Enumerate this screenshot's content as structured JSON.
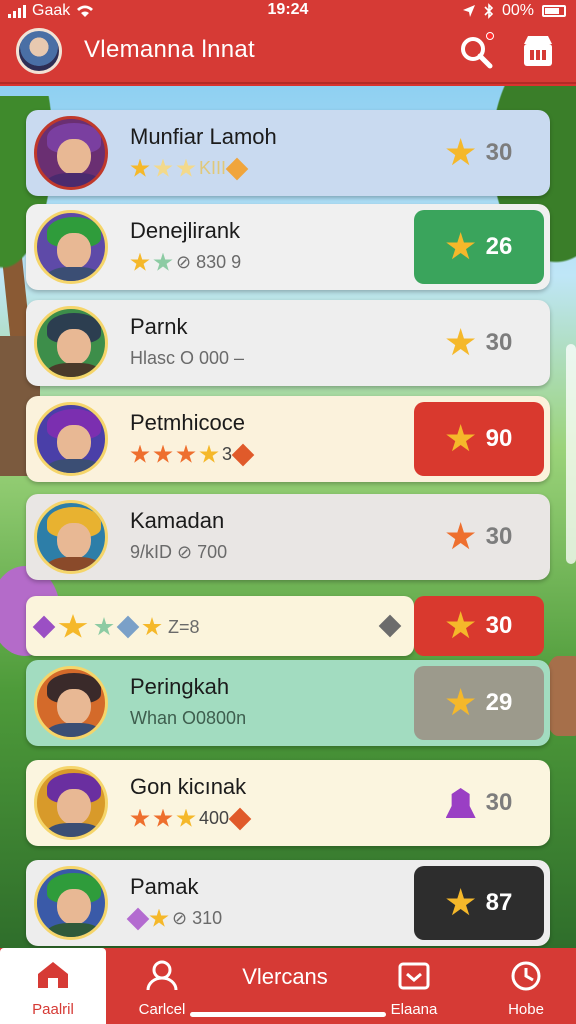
{
  "status_bar": {
    "carrier": "Gaak",
    "time": "19:24",
    "battery": "00%"
  },
  "header": {
    "title": "Vlemanna lnnat",
    "search_icon": "search-icon",
    "shop_icon": "shop-icon"
  },
  "rows": [
    {
      "name": "Munfiar Lamoh",
      "sub": "KIII",
      "score": "30",
      "score_bg": "none"
    },
    {
      "name": "Denejlirank",
      "sub": "⊘ 830 9",
      "score": "26",
      "score_bg": "#3aa45c"
    },
    {
      "name": "Parnk",
      "sub": "Hlasc O 000 –",
      "score": "30",
      "score_bg": "none"
    },
    {
      "name": "Petmhicoce",
      "sub": "3",
      "score": "90",
      "score_bg": "#d9392e"
    },
    {
      "name": "Kamadan",
      "sub": "9/kID ⊘ 700",
      "score": "30",
      "score_bg": "none"
    },
    {
      "name": "",
      "sub": "Z=8",
      "score": "30",
      "score_bg": "#d9392e"
    },
    {
      "name": "Peringkah",
      "sub": "Whan O0800n",
      "score": "29",
      "score_bg": "#9c9a8c"
    },
    {
      "name": "Gon kicınak",
      "sub": "400",
      "score": "30",
      "score_bg": "none"
    },
    {
      "name": "Pamak",
      "sub": "⊘ 310",
      "score": "87",
      "score_bg": "#2d2d2d"
    }
  ],
  "bottom_nav": {
    "home_label": "Paalril",
    "profile_label": "Carlcel",
    "center_title": "Vlercans",
    "events_label": "Elaana",
    "hobe_label": "Hobe"
  }
}
